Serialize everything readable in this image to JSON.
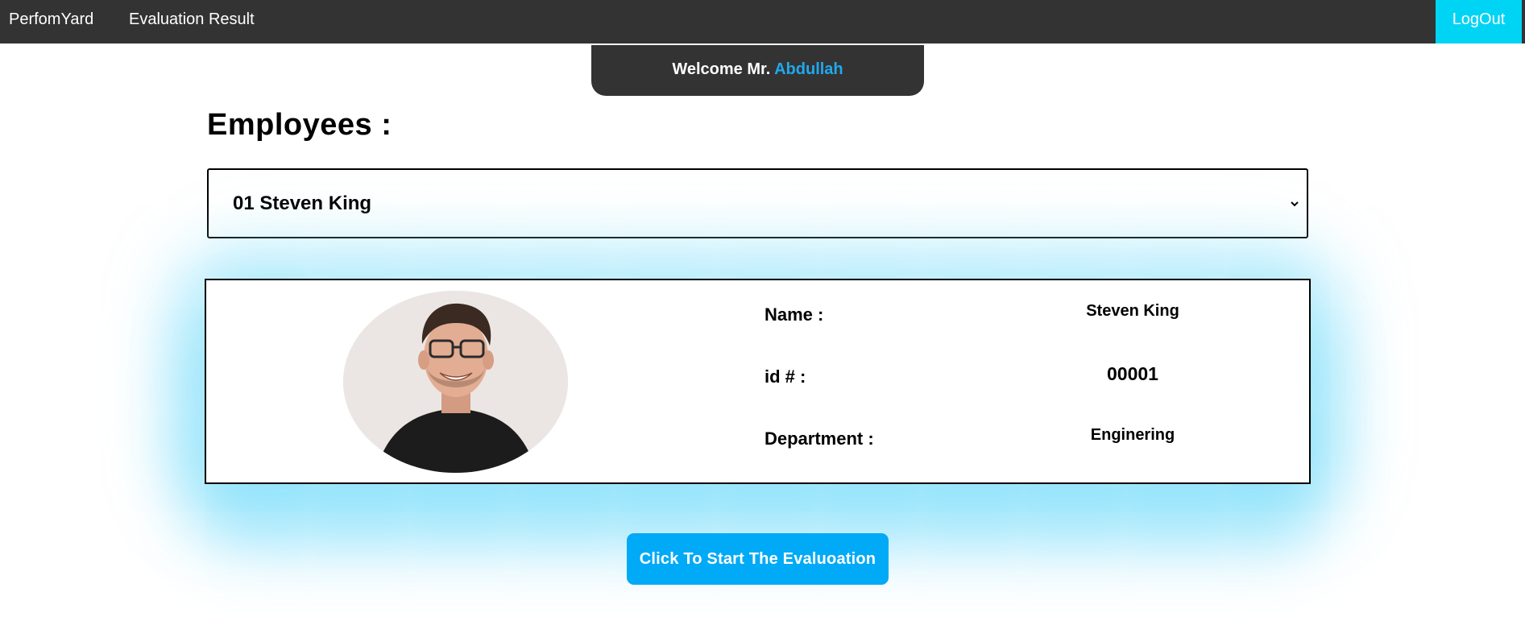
{
  "navbar": {
    "brand": "PerfomYard",
    "evaluation_result": "Evaluation Result",
    "logout": "LogOut",
    "logout_color": "#00d4f5",
    "background": "#333333"
  },
  "welcome": {
    "prefix": "Welcome Mr.",
    "user": "Abdullah",
    "user_color": "#1fa9ee"
  },
  "page_title": "Employees :",
  "employee_select": {
    "selected": "01 Steven King",
    "icon": "chevron-down-icon"
  },
  "employee_card": {
    "photo_icon": "employee-photo",
    "name_label": "Name :",
    "name_value": "Steven King",
    "id_label": "id # :",
    "id_value": "00001",
    "department_label": "Department :",
    "department_value": "Enginering"
  },
  "start_button": {
    "label": "Click To Start The Evaluoation",
    "color": "#00aaf7"
  }
}
